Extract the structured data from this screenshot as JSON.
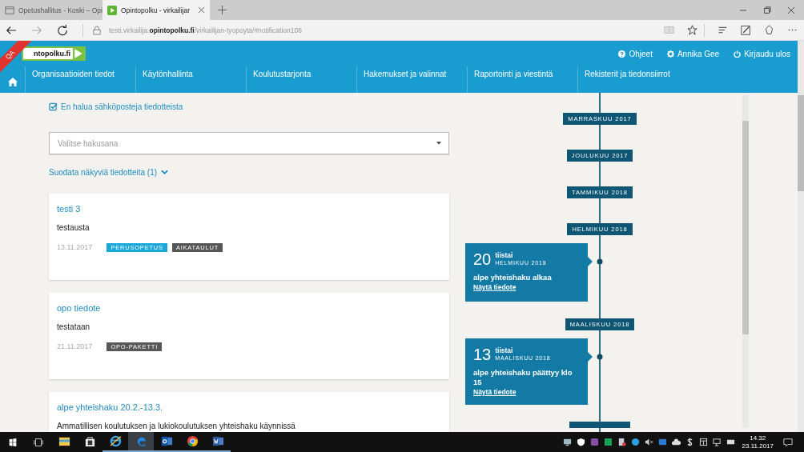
{
  "browser": {
    "tabs": [
      {
        "title": "Opetushallitus - Koski – Opi",
        "selected": false
      },
      {
        "title": "Opintopolku - virkailijar",
        "selected": true
      }
    ],
    "address": "testi.virkailija.**opintopolku.fi**/virkailijan-tyopoyta/#notification106"
  },
  "header": {
    "ribbon": "QA",
    "logo": "ntopolku.fi",
    "links": [
      {
        "kind": "help",
        "label": "Ohjeet"
      },
      {
        "kind": "user",
        "label": "Annika Gee"
      },
      {
        "kind": "logout",
        "label": "Kirjaudu ulos"
      }
    ],
    "nav": [
      "Organisaatioiden tiedot",
      "Käytönhallinta",
      "Koulutustarjonta",
      "Hakemukset ja valinnat",
      "Raportointi ja viestintä",
      "Rekisterit ja tiedonsiirrot"
    ]
  },
  "email_optout": {
    "label": "En halua sähköposteja tiedotteista",
    "checked": true
  },
  "search": {
    "placeholder": "Valitse hakusana"
  },
  "filter": {
    "label": "Suodata näkyviä tiedotteita (1)",
    "expanded": false
  },
  "notifications": [
    {
      "title": "testi 3",
      "body": "testausta",
      "date": "13.11.2017",
      "tags": [
        {
          "label": "PERUSOPETUS",
          "color": "#1aa8da"
        },
        {
          "label": "AIKATAULUT",
          "color": "#575757"
        }
      ]
    },
    {
      "title": "opo tiedote",
      "body": "testataan",
      "date": "21.11.2017",
      "tags": [
        {
          "label": "OPO-PAKETTI",
          "color": "#575757"
        }
      ]
    },
    {
      "title": "alpe yhteishaku 20.2.-13.3.",
      "body": "Ammatillisen koulutuksen ja lukiokoulutuksen yhteishaku käynnissä"
    }
  ],
  "timeline": [
    {
      "kind": "month",
      "label": "MARRASKUU 2017"
    },
    {
      "kind": "month",
      "label": "JOULUKUU 2017"
    },
    {
      "kind": "month",
      "label": "TAMMIKUU 2018"
    },
    {
      "kind": "month",
      "label": "HELMIKUU 2018"
    },
    {
      "kind": "event",
      "day": "20",
      "weekday": "tiistai",
      "month": "HELMIKUU 2018",
      "text": "alpe yhteishaku alkaa",
      "link": "Näytä tiedote"
    },
    {
      "kind": "month",
      "label": "MAALISKUU 2018"
    },
    {
      "kind": "event",
      "day": "13",
      "weekday": "tiistai",
      "month": "MAALISKUU 2018",
      "text": "alpe yhteishaku päättyy klo 15",
      "link": "Näytä tiedote"
    },
    {
      "kind": "stub"
    }
  ],
  "taskbar": {
    "apps": [
      {
        "kind": "explorer",
        "running": false,
        "selected": false
      },
      {
        "kind": "store",
        "running": false,
        "selected": false
      },
      {
        "kind": "ie",
        "running": true,
        "selected": false
      },
      {
        "kind": "edge",
        "running": true,
        "selected": true
      },
      {
        "kind": "outlook",
        "running": true,
        "selected": false
      },
      {
        "kind": "chrome",
        "running": true,
        "selected": false
      },
      {
        "kind": "word",
        "running": true,
        "selected": false
      }
    ],
    "time": "14.32",
    "date": "23.11.2017"
  }
}
